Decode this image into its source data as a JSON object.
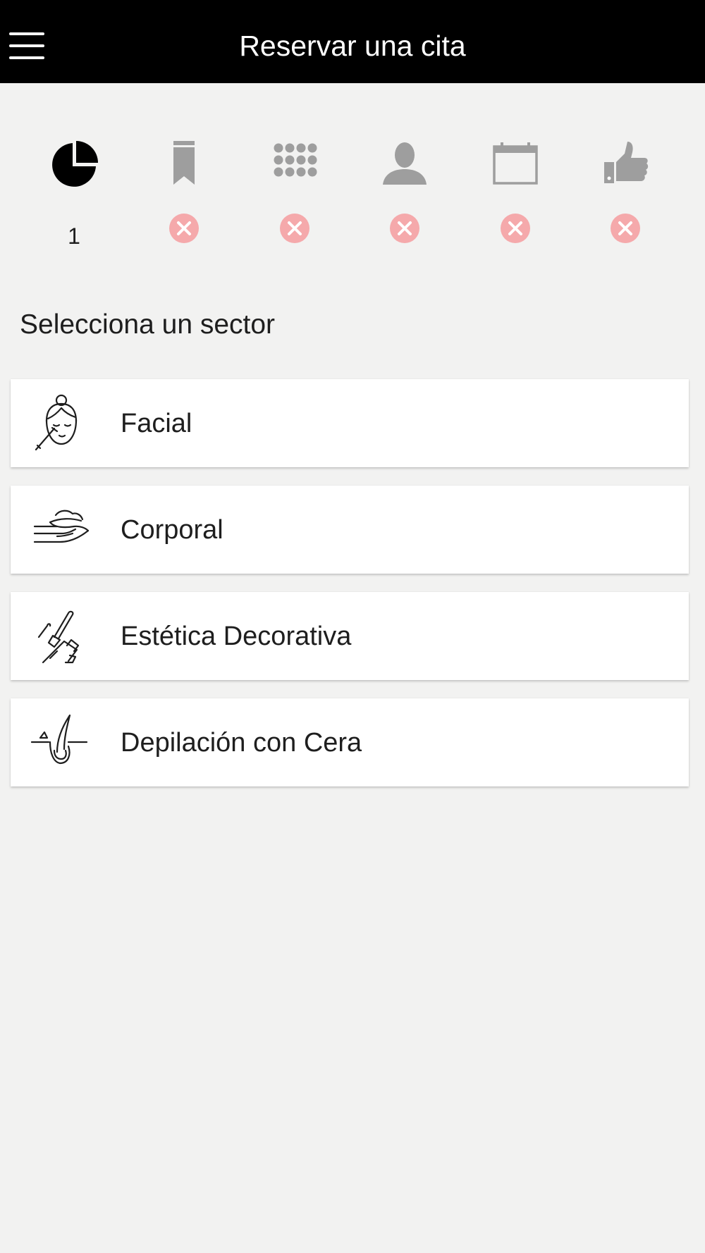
{
  "header": {
    "title": "Reservar una cita"
  },
  "steps": [
    {
      "icon": "pie-chart-icon",
      "state": "active",
      "label": "1"
    },
    {
      "icon": "bookmark-icon",
      "state": "pending"
    },
    {
      "icon": "grid-icon",
      "state": "pending"
    },
    {
      "icon": "user-icon",
      "state": "pending"
    },
    {
      "icon": "calendar-icon",
      "state": "pending"
    },
    {
      "icon": "thumbs-up-icon",
      "state": "pending"
    }
  ],
  "section": {
    "title": "Selecciona un sector"
  },
  "sectors": [
    {
      "icon": "facial-icon",
      "label": "Facial"
    },
    {
      "icon": "body-massage-icon",
      "label": "Corporal"
    },
    {
      "icon": "makeup-brush-icon",
      "label": "Estética Decorativa"
    },
    {
      "icon": "wax-hair-icon",
      "label": "Depilación con Cera"
    }
  ],
  "colors": {
    "topbar": "#000000",
    "background": "#f2f2f1",
    "inactive_icon": "#9e9e9e",
    "pending_badge": "#f5a9ab"
  }
}
